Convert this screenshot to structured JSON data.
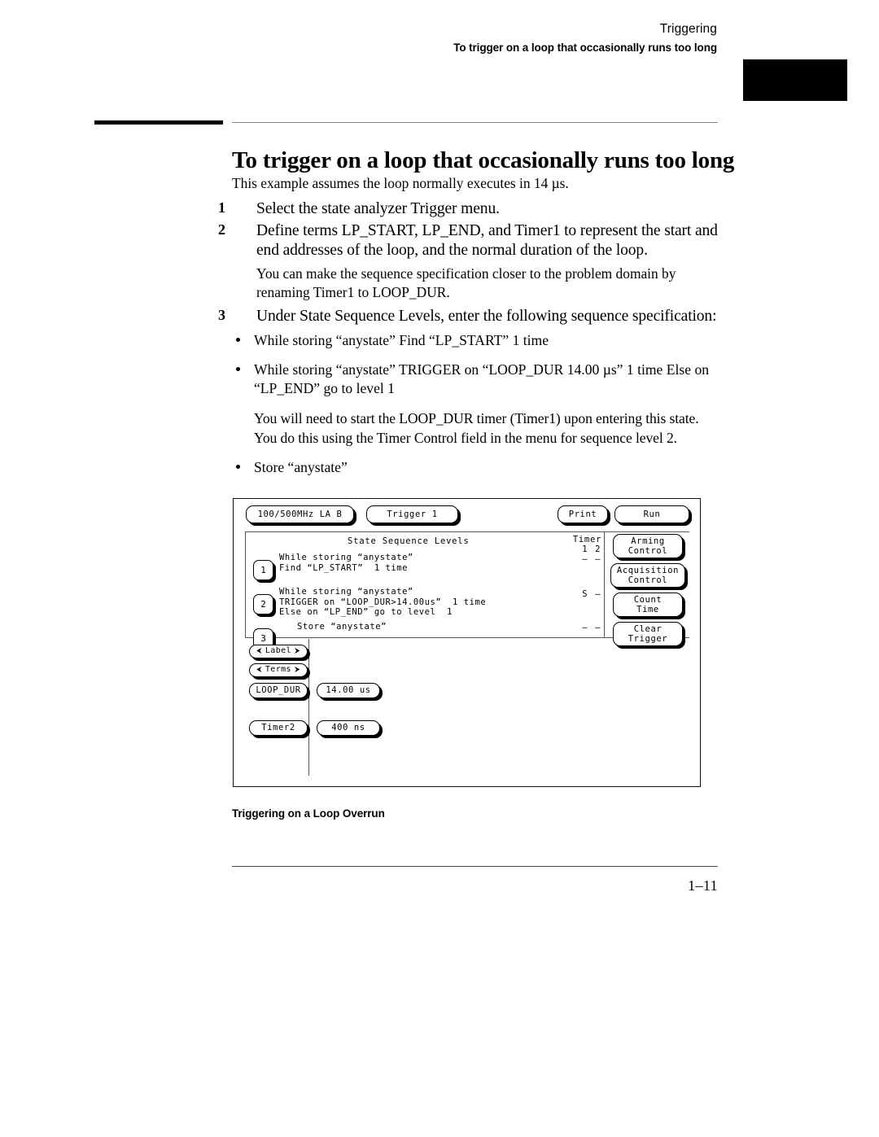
{
  "header": {
    "chapter": "Triggering",
    "section": "To trigger on a loop that occasionally runs too long"
  },
  "title": "To trigger on a loop that occasionally runs too long",
  "intro": "This example assumes the loop normally executes in 14 µs.",
  "steps": [
    {
      "num": "1",
      "text": "Select the state analyzer Trigger menu."
    },
    {
      "num": "2",
      "text": "Define terms LP_START, LP_END, and Timer1 to represent the start and end addresses of the loop, and the normal duration of the loop.",
      "note": "You can make the sequence specification closer to the problem domain by renaming Timer1 to LOOP_DUR."
    },
    {
      "num": "3",
      "text": "Under State Sequence Levels, enter the following sequence specification:"
    }
  ],
  "bullets": [
    {
      "text": "While storing “anystate” Find “LP_START” 1 time"
    },
    {
      "text": "While storing “anystate” TRIGGER on “LOOP_DUR  14.00 µs” 1 time Else on “LP_END” go to level 1"
    },
    {
      "text": "Store “anystate”"
    }
  ],
  "bullet_note": "You will need to start the LOOP_DUR timer (Timer1) upon entering this state. You do this using the Timer Control field in the menu for sequence level 2.",
  "figure": {
    "caption": "Triggering on a Loop Overrun",
    "topbar": {
      "module": "100/500MHz LA B",
      "trigger": "Trigger 1",
      "print": "Print",
      "run": "Run"
    },
    "panel_title": "State Sequence Levels",
    "timer": {
      "header": "Timer",
      "sub": "1 2",
      "rows": [
        "– –",
        "S –",
        "– –"
      ]
    },
    "sequence_levels": [
      {
        "number": "1",
        "lines": "While storing “anystate”\nFind “LP_START”  1 time"
      },
      {
        "number": "2",
        "lines": "While storing “anystate”\nTRIGGER on “LOOP_DUR>14.00us”  1 time\nElse on “LP_END” go to level  1"
      },
      {
        "number": "3",
        "lines": "Store “anystate”"
      }
    ],
    "softkeys": [
      {
        "line1": "Arming",
        "line2": "Control"
      },
      {
        "line1": "Acquisition",
        "line2": "Control"
      },
      {
        "line1": "Count",
        "line2": "Time"
      },
      {
        "line1": "Clear",
        "line2": "Trigger"
      }
    ],
    "lower": {
      "label": "Label",
      "terms": "Terms",
      "arrow_left": "⮜",
      "arrow_right": "⮞",
      "term_rows": [
        {
          "name": "LOOP_DUR",
          "value": "14.00 us"
        },
        {
          "name": "Timer2",
          "value": "400 ns"
        }
      ]
    }
  },
  "footer": {
    "page_number": "1–11"
  }
}
